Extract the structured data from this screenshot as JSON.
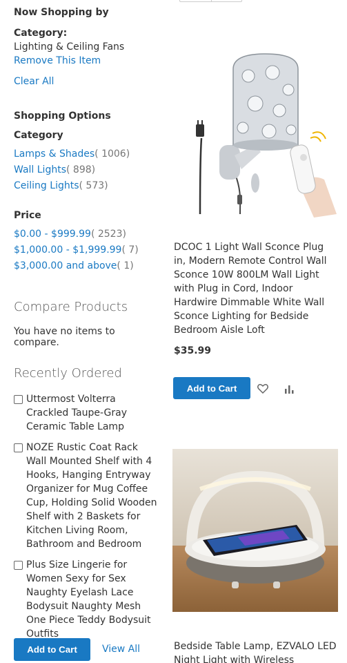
{
  "sidebar": {
    "now_shopping": "Now Shopping by",
    "filter_label": "Category:",
    "filter_value": "Lighting & Ceiling Fans",
    "remove_label": "Remove This Item",
    "clear_all_label": "Clear All",
    "shopping_options": "Shopping Options",
    "category_title": "Category",
    "categories": [
      {
        "label": "Lamps & Shades",
        "count": "( 1006)"
      },
      {
        "label": "Wall Lights",
        "count": "( 898)"
      },
      {
        "label": "Ceiling Lights",
        "count": "( 573)"
      }
    ],
    "price_title": "Price",
    "prices": [
      {
        "label": "$0.00 - $999.99",
        "count": "( 2523)"
      },
      {
        "label": "$1,000.00 - $1,999.99",
        "count": "( 7)"
      },
      {
        "label": "$3,000.00 and above",
        "count": "( 1)"
      }
    ],
    "compare_title": "Compare Products",
    "compare_empty": "You have no items to compare.",
    "recent_title": "Recently Ordered",
    "recent_items": [
      "Uttermost Volterra Crackled Taupe-Gray Ceramic Table Lamp",
      "NOZE Rustic Coat Rack Wall Mounted Shelf with 4 Hooks, Hanging Entryway Organizer for Mug Coffee Cup, Holding Solid Wooden Shelf with 2 Baskets for Kitchen Living Room, Bathroom and Bedroom",
      "Plus Size Lingerie for Women Sexy for Sex Naughty Eyelash Lace Bodysuit Naughty Mesh One Piece Teddy Bodysuit Outfits"
    ],
    "add_to_cart_label": "Add to Cart",
    "view_all_label": "View All"
  },
  "products": [
    {
      "name": "DCOC 1 Light Wall Sconce Plug in, Modern Remote Control Wall Sconce 10W 800LM Wall Light with Plug in Cord, Indoor Hardwire Dimmable White Wall Sconce Lighting for Bedside Bedroom Aisle Loft",
      "price": "$35.99",
      "add_to_cart_label": "Add to Cart",
      "image_icon": "wall-sconce-image"
    },
    {
      "name": "Bedside Table Lamp, EZVALO LED Night Light with Wireless Charger,",
      "image_icon": "wireless-charger-lamp-image"
    }
  ],
  "colors": {
    "link": "#1979c3",
    "primary_button": "#1979c3",
    "text": "#333333"
  }
}
